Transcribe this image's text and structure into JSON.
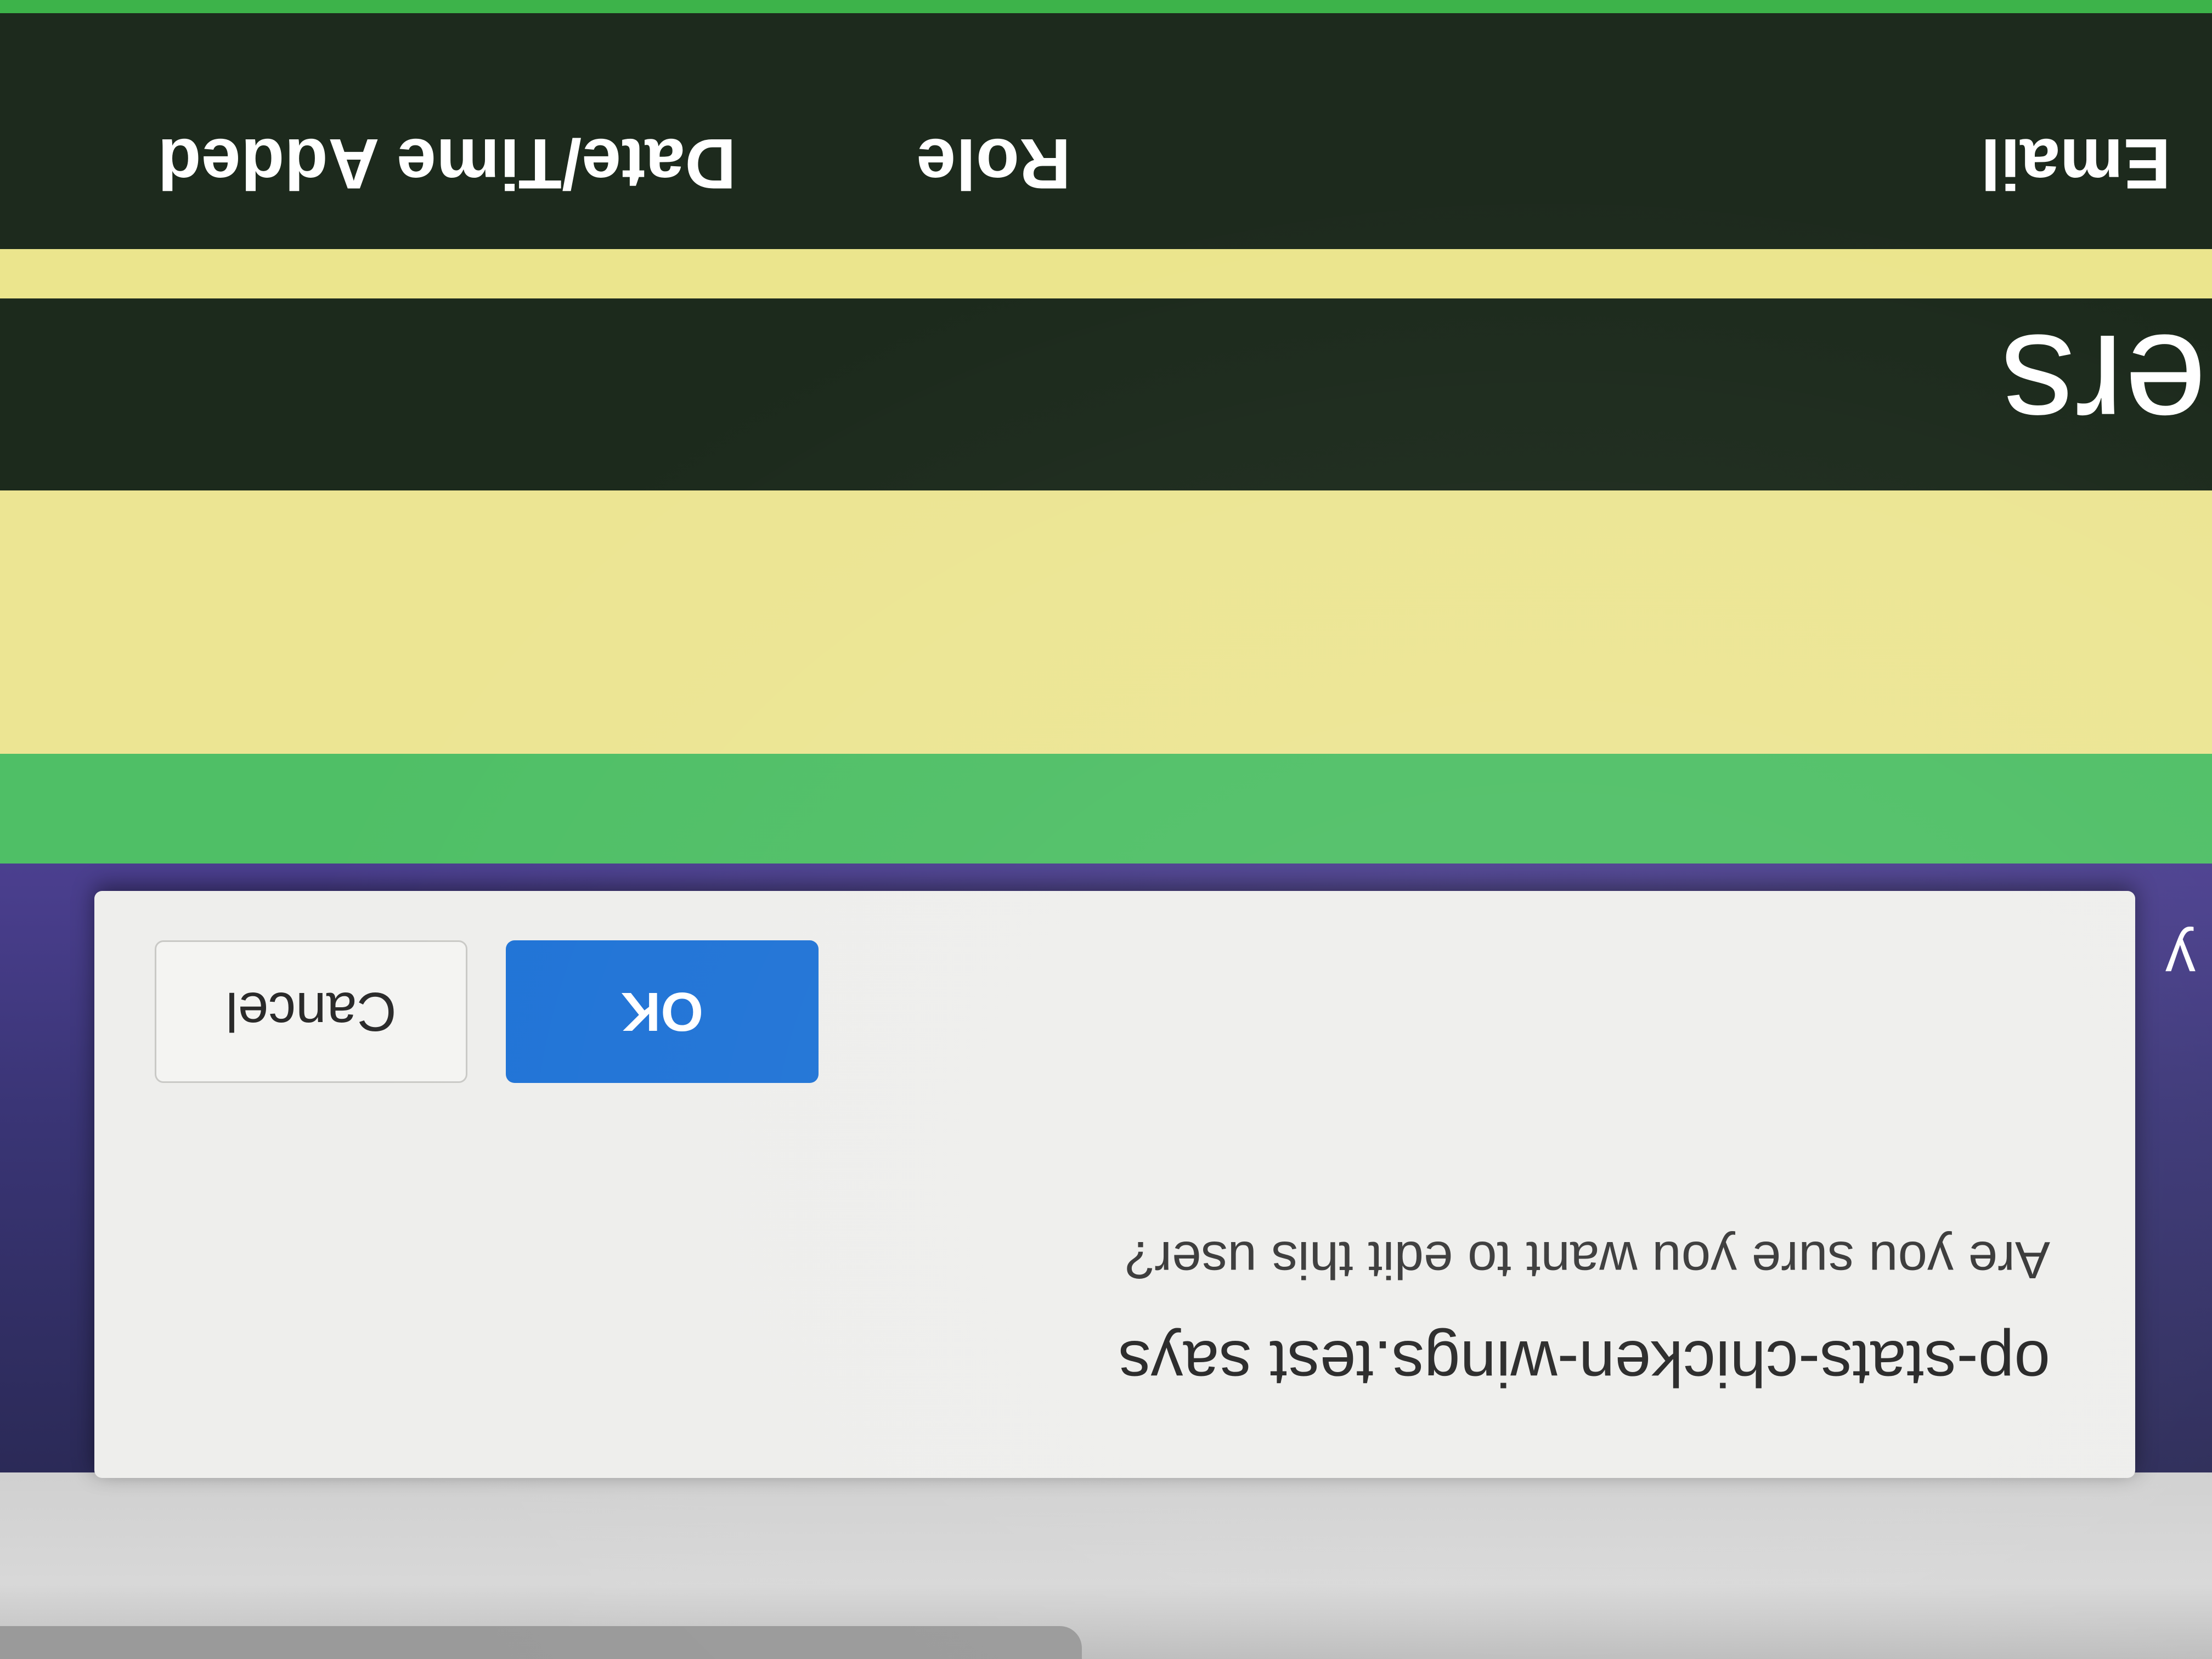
{
  "page": {
    "title_fragment": "ers",
    "nav_fragment": "y"
  },
  "table": {
    "columns": [
      "Email",
      "Role",
      "Date/Time Added"
    ]
  },
  "dialog": {
    "title": "op-stats-chicken-wings.test says",
    "message": "Are you sure you want to edit this user?",
    "ok_label": "OK",
    "cancel_label": "Cancel"
  },
  "colors": {
    "nav_purple": "#3a3576",
    "accent_green": "#4fbf66",
    "header_yellow": "#ece593",
    "header_dark": "#1c2a1c",
    "ok_blue": "#1f73d6"
  }
}
